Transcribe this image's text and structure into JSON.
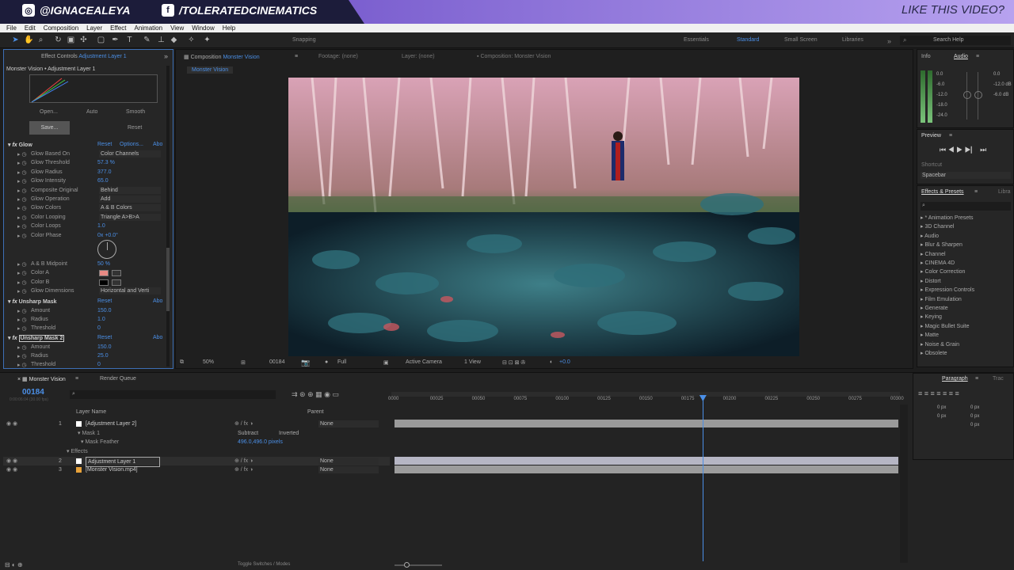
{
  "banner": {
    "instagram": "@IGNACEALEYA",
    "facebook": "/TOLERATEDCINEMATICS",
    "like": "LIKE THIS VIDEO?"
  },
  "menu": [
    "File",
    "Edit",
    "Composition",
    "Layer",
    "Effect",
    "Animation",
    "View",
    "Window",
    "Help"
  ],
  "toolbar": {
    "snapping": "Snapping",
    "workspaces": [
      "Essentials",
      "Standard",
      "Small Screen",
      "Libraries"
    ],
    "search_placeholder": "Search Help"
  },
  "effect_controls": {
    "tab": "Effect Controls",
    "tab_target": "Adjustment Layer 1",
    "breadcrumb": "Monster Vision • Adjustment Layer 1",
    "curve_buttons": [
      "Open...",
      "Auto",
      "Smooth"
    ],
    "save": "Save...",
    "reset": "Reset",
    "glow": {
      "name": "Glow",
      "reset": "Reset",
      "options": "Options...",
      "about": "Abo",
      "props": [
        {
          "label": "Glow Based On",
          "value": "Color Channels",
          "type": "dropdown"
        },
        {
          "label": "Glow Threshold",
          "value": "57.3 %",
          "type": "value"
        },
        {
          "label": "Glow Radius",
          "value": "377.0",
          "type": "value"
        },
        {
          "label": "Glow Intensity",
          "value": "65.0",
          "type": "value"
        },
        {
          "label": "Composite Original",
          "value": "Behind",
          "type": "dropdown"
        },
        {
          "label": "Glow Operation",
          "value": "Add",
          "type": "dropdown"
        },
        {
          "label": "Glow Colors",
          "value": "A & B Colors",
          "type": "dropdown"
        },
        {
          "label": "Color Looping",
          "value": "Triangle A>B>A",
          "type": "dropdown"
        },
        {
          "label": "Color Loops",
          "value": "1.0",
          "type": "value"
        },
        {
          "label": "Color Phase",
          "value": "0x +0.0°",
          "type": "value"
        }
      ],
      "props2": [
        {
          "label": "A & B Midpoint",
          "value": "50 %",
          "type": "value"
        },
        {
          "label": "Color A",
          "value": "",
          "type": "swatch",
          "color": "#e88a84"
        },
        {
          "label": "Color B",
          "value": "",
          "type": "swatch",
          "color": "#000000"
        },
        {
          "label": "Glow Dimensions",
          "value": "Horizontal and Verti",
          "type": "dropdown"
        }
      ]
    },
    "unsharp1": {
      "name": "Unsharp Mask",
      "reset": "Reset",
      "about": "Abo",
      "props": [
        {
          "label": "Amount",
          "value": "150.0"
        },
        {
          "label": "Radius",
          "value": "1.0"
        },
        {
          "label": "Threshold",
          "value": "0"
        }
      ]
    },
    "unsharp2": {
      "name": "Unsharp Mask 2",
      "reset": "Reset",
      "about": "Abo",
      "props": [
        {
          "label": "Amount",
          "value": "150.0"
        },
        {
          "label": "Radius",
          "value": "25.0"
        },
        {
          "label": "Threshold",
          "value": "0"
        }
      ]
    }
  },
  "composition": {
    "tab": "Composition",
    "tab_name": "Monster Vision",
    "footage": "Footage: (none)",
    "layer": "Layer: (none)",
    "comp2": "Composition: Monster Vision",
    "sub_tab": "Monster Vision",
    "zoom": "50%",
    "timecode": "00184",
    "resolution": "Full",
    "camera": "Active Camera",
    "view": "1 View",
    "exposure": "+0.0"
  },
  "right": {
    "info": "Info",
    "audio": "Audio",
    "audio_levels": [
      "0.0",
      "-6.0",
      "-12.0",
      "-18.0",
      "-24.0"
    ],
    "audio_db": [
      "0.0",
      "-12.0 dB",
      "-6.0 dB"
    ],
    "preview": "Preview",
    "shortcut_label": "Shortcut",
    "shortcut": "Spacebar",
    "effects_tab": "Effects & Presets",
    "libraries_tab": "Libra",
    "categories": [
      "* Animation Presets",
      "3D Channel",
      "Audio",
      "Blur & Sharpen",
      "Channel",
      "CINEMA 4D",
      "Color Correction",
      "Distort",
      "Expression Controls",
      "Film Emulation",
      "Generate",
      "Keying",
      "Magic Bullet Suite",
      "Matte",
      "Noise & Grain",
      "Obsolete"
    ],
    "paragraph": "Paragraph",
    "track": "Trac",
    "para_vals": [
      "0 px",
      "0 px",
      "0 px",
      "0 px",
      "0 px"
    ]
  },
  "timeline": {
    "tab": "Monster Vision",
    "render_queue": "Render Queue",
    "timecode": "00184",
    "timecode_sub": "0:00:06:04 (30.00 fps)",
    "col_layer": "Layer Name",
    "col_parent": "Parent",
    "ruler": [
      "0000",
      "00025",
      "00050",
      "00075",
      "00100",
      "00125",
      "00150",
      "00175",
      "00200",
      "00225",
      "00250",
      "00275",
      "00300"
    ],
    "playhead_frame": 184,
    "layers": [
      {
        "num": "1",
        "name": "[Adjustment Layer 2]",
        "parent": "None"
      },
      {
        "num": "",
        "name": "Mask 1",
        "mode": "Subtract",
        "inverted": "Inverted"
      },
      {
        "num": "",
        "name": "Mask Feather",
        "value": "496.0,496.0 pixels"
      },
      {
        "num": "",
        "name": "Effects"
      },
      {
        "num": "2",
        "name": "Adjustment Layer 1",
        "parent": "None"
      },
      {
        "num": "3",
        "name": "[Monster Vision.mp4]",
        "parent": "None"
      }
    ],
    "toggle": "Toggle Switches / Modes"
  }
}
